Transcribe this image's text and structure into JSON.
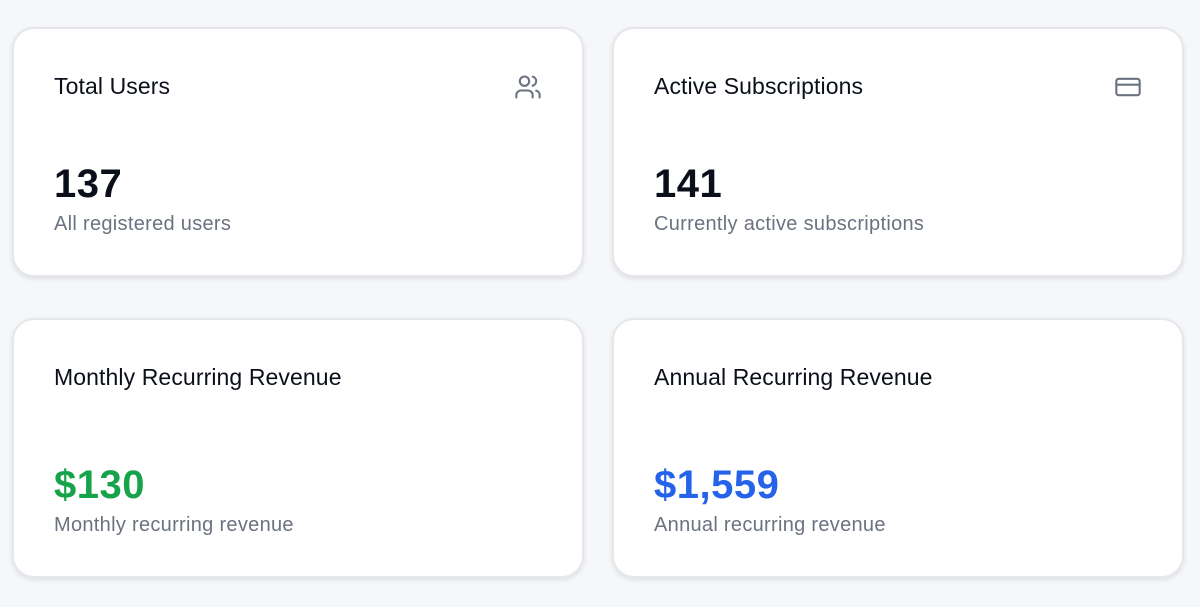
{
  "cards": [
    {
      "title": "Total Users",
      "icon": "users-icon",
      "value": "137",
      "caption": "All registered users"
    },
    {
      "title": "Active Subscriptions",
      "icon": "credit-card-icon",
      "value": "141",
      "caption": "Currently active subscriptions"
    },
    {
      "title": "Monthly Recurring Revenue",
      "value": "$130",
      "value_color": "#16a34a",
      "caption": "Monthly recurring revenue"
    },
    {
      "title": "Annual Recurring Revenue",
      "value": "$1,559",
      "value_color": "#2563eb",
      "caption": "Annual recurring revenue"
    }
  ]
}
